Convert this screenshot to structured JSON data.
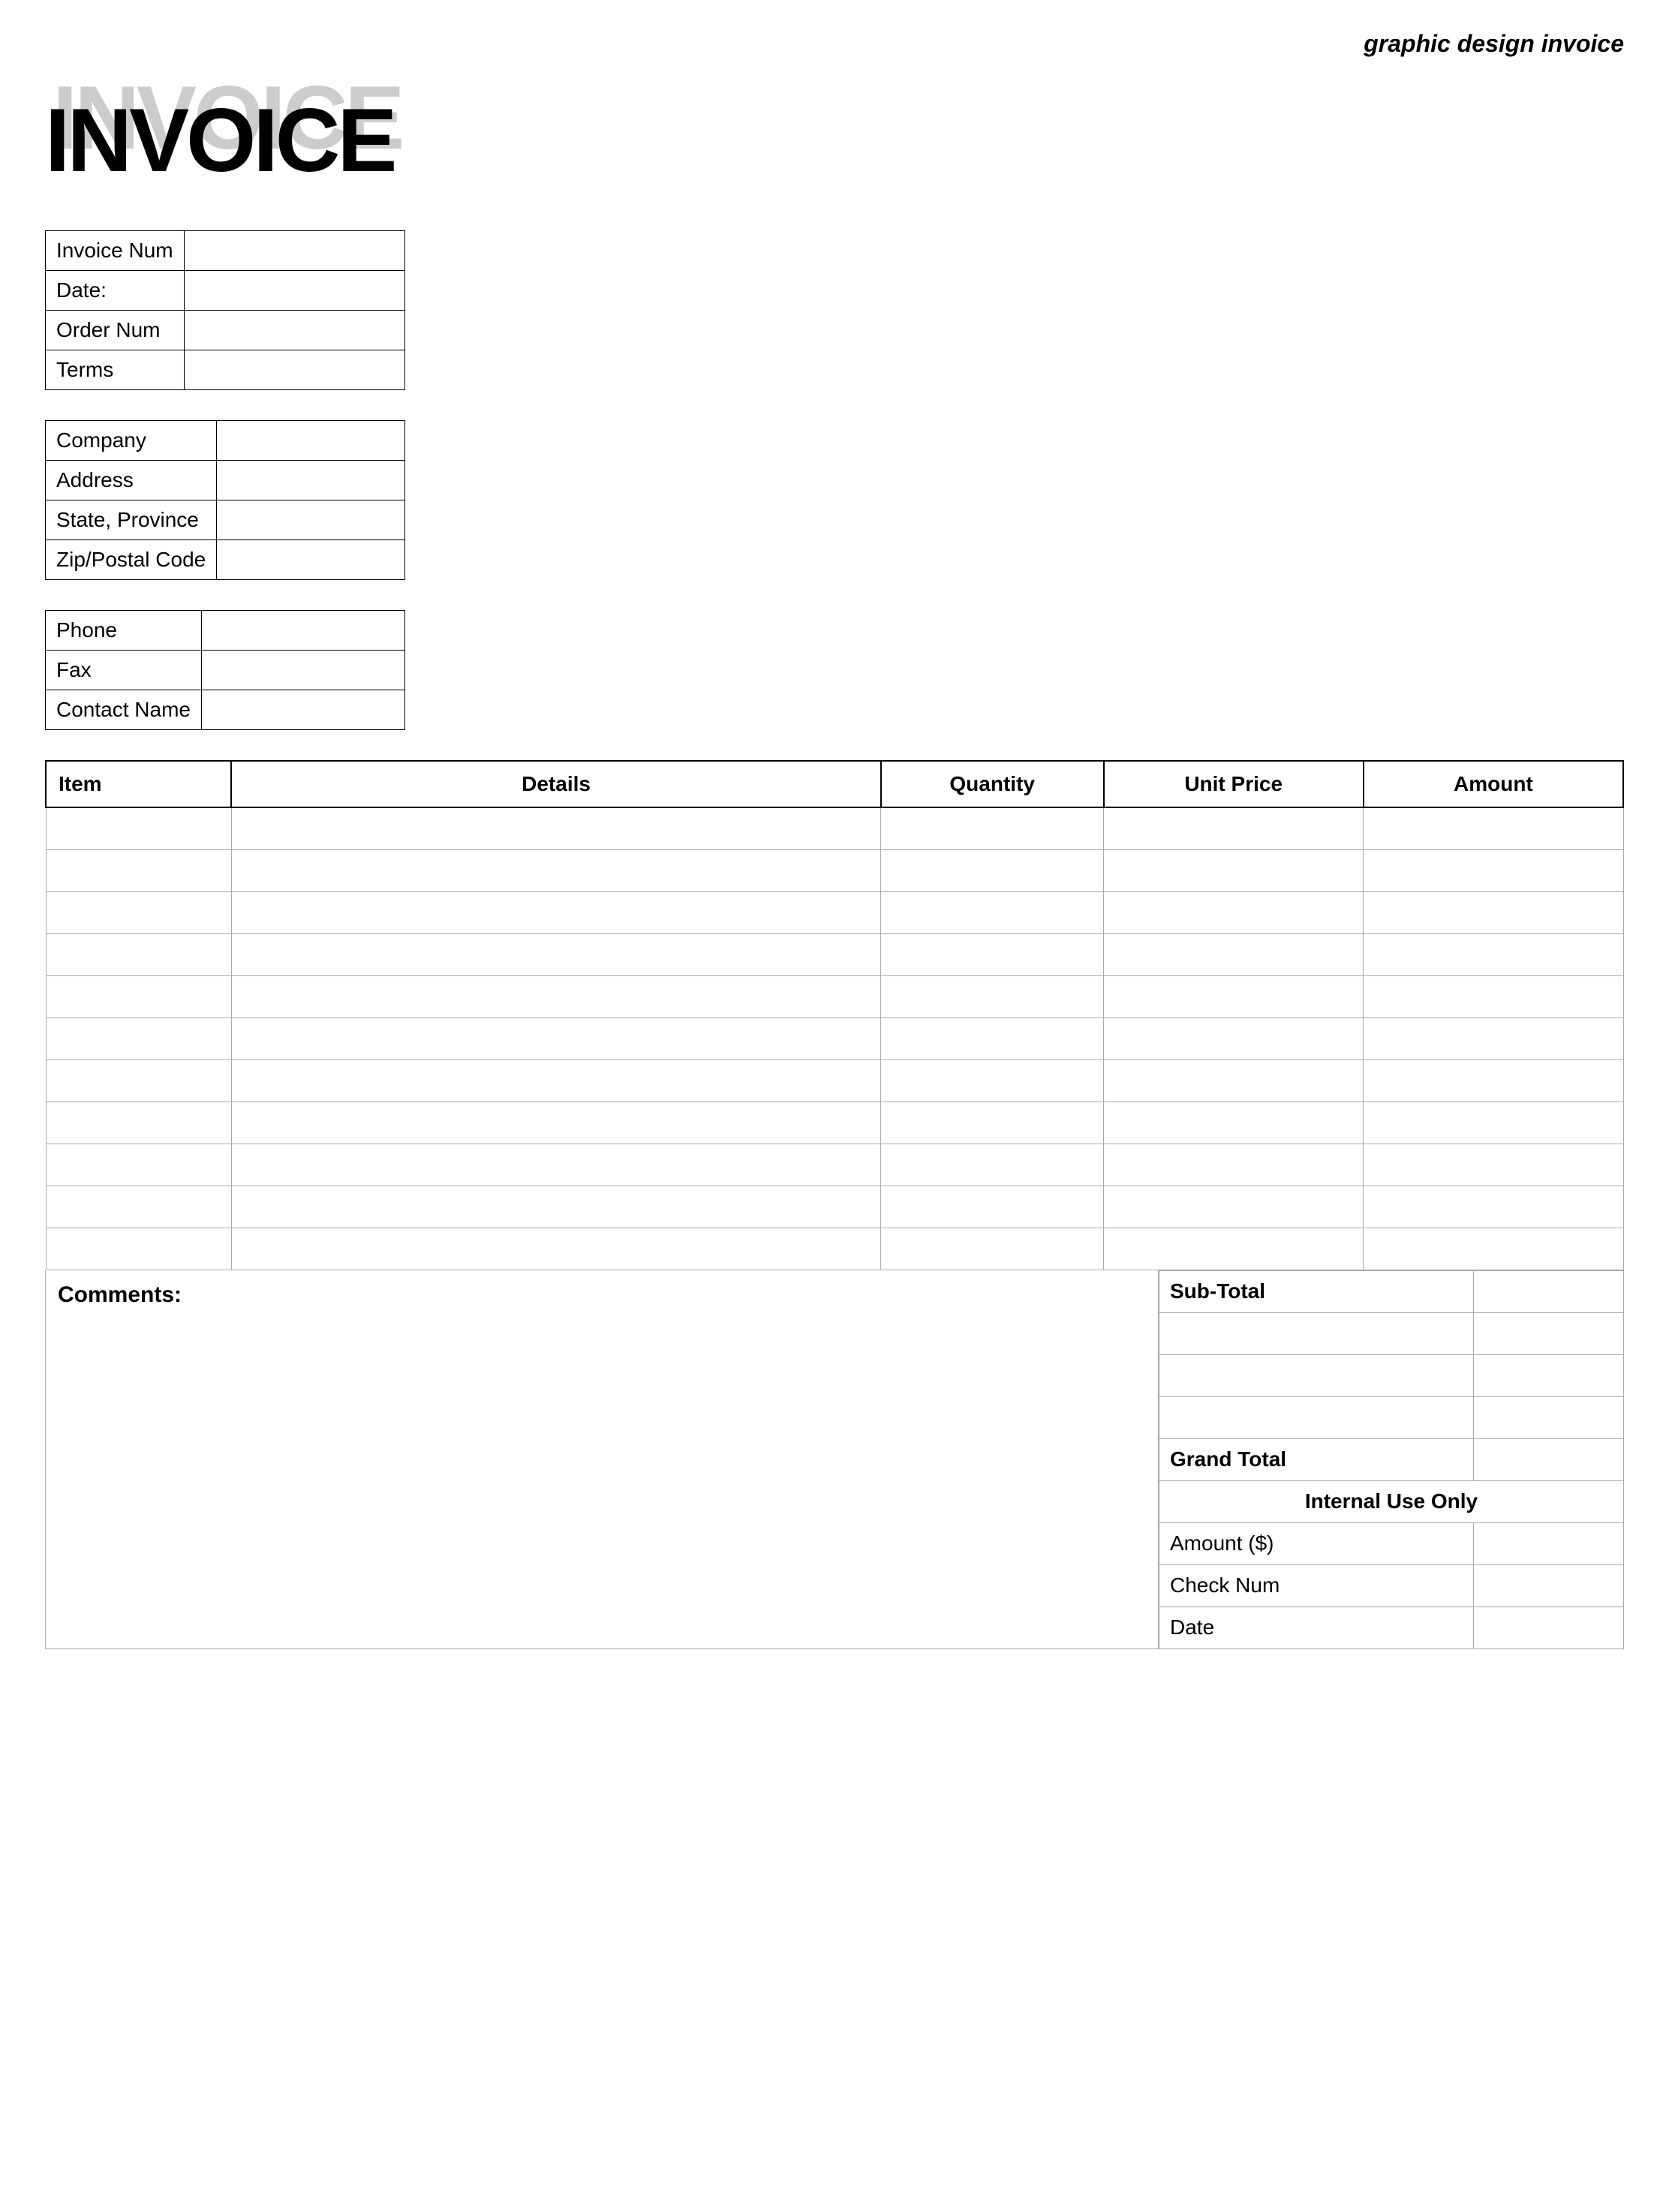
{
  "header": {
    "title": "graphic design invoice"
  },
  "invoice_title": "INVOICE",
  "invoice_info": {
    "fields": [
      {
        "label": "Invoice Num",
        "value": ""
      },
      {
        "label": "Date:",
        "value": ""
      },
      {
        "label": "Order Num",
        "value": ""
      },
      {
        "label": "Terms",
        "value": ""
      }
    ]
  },
  "company_info": {
    "fields": [
      {
        "label": "Company",
        "value": ""
      },
      {
        "label": "Address",
        "value": ""
      },
      {
        "label": "State, Province",
        "value": ""
      },
      {
        "label": "Zip/Postal Code",
        "value": ""
      }
    ]
  },
  "contact_info": {
    "fields": [
      {
        "label": "Phone",
        "value": ""
      },
      {
        "label": "Fax",
        "value": ""
      },
      {
        "label": "Contact Name",
        "value": ""
      }
    ]
  },
  "items_table": {
    "columns": [
      "Item",
      "Details",
      "Quantity",
      "Unit Price",
      "Amount"
    ],
    "rows": [
      [
        "",
        "",
        "",
        "",
        ""
      ],
      [
        "",
        "",
        "",
        "",
        ""
      ],
      [
        "",
        "",
        "",
        "",
        ""
      ],
      [
        "",
        "",
        "",
        "",
        ""
      ],
      [
        "",
        "",
        "",
        "",
        ""
      ],
      [
        "",
        "",
        "",
        "",
        ""
      ],
      [
        "",
        "",
        "",
        "",
        ""
      ],
      [
        "",
        "",
        "",
        "",
        ""
      ],
      [
        "",
        "",
        "",
        "",
        ""
      ],
      [
        "",
        "",
        "",
        "",
        ""
      ],
      [
        "",
        "",
        "",
        "",
        ""
      ]
    ]
  },
  "comments": {
    "label": "Comments:"
  },
  "totals": {
    "subtotal_label": "Sub-Total",
    "rows": [
      "",
      "",
      "",
      ""
    ],
    "grand_total_label": "Grand Total",
    "internal_use_label": "Internal Use Only",
    "internal_fields": [
      {
        "label": "Amount ($)",
        "value": ""
      },
      {
        "label": "Check Num",
        "value": ""
      },
      {
        "label": "Date",
        "value": ""
      }
    ]
  }
}
